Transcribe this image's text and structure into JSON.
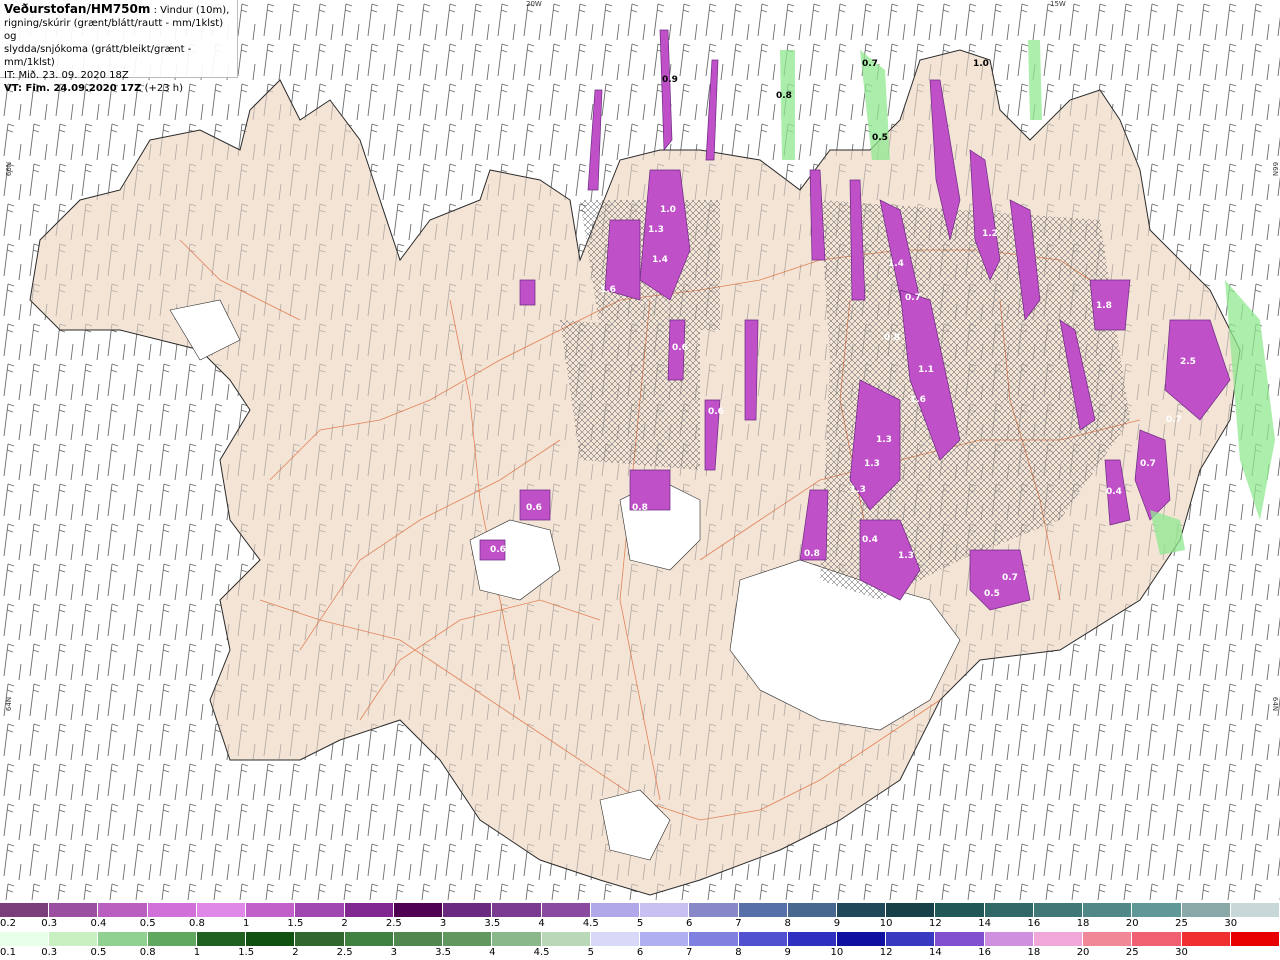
{
  "title": {
    "source": "Veðurstofan/HM750m",
    "desc_line1": " : Vindur (10m),",
    "desc_line2": "rigning/skúrir (grænt/blátt/rautt - mm/1klst) og",
    "desc_line3": "slydda/snjókoma (grátt/bleikt/grænt - mm/1klst)",
    "it": "IT: Mið. 23. 09. 2020 18Z",
    "vt": "VT: Fim. 24.09.2020 17Z",
    "lead": "(+23 h)"
  },
  "graticule": {
    "top_20w": "20W",
    "top_15w": "15W",
    "left_66n": "66N",
    "left_64n": "64N",
    "right_66n": "66N",
    "right_64n": "64N"
  },
  "legend_snow": {
    "labels": [
      "0.2",
      "0.3",
      "0.4",
      "0.5",
      "0.8",
      "1",
      "1.5",
      "2",
      "2.5",
      "3",
      "3.5",
      "4",
      "4.5",
      "5",
      "6",
      "7",
      "8",
      "9",
      "10",
      "12",
      "14",
      "16",
      "18",
      "20",
      "25",
      "30"
    ],
    "colors": [
      "#7a3f7a",
      "#9a4fa0",
      "#b85fc0",
      "#d070d8",
      "#e088e8",
      "#c060c8",
      "#a048b0",
      "#802890",
      "#500050",
      "#6a2a80",
      "#7a3a90",
      "#8a4aa0",
      "#b0a8e8",
      "#c8c0f0",
      "#8888c8",
      "#5870a8",
      "#486890",
      "#204858",
      "#184048",
      "#205858",
      "#306868",
      "#407878",
      "#508888",
      "#609898",
      "#8aa8a8",
      "#c8d8d8"
    ]
  },
  "legend_rain": {
    "labels": [
      "0.1",
      "0.3",
      "0.5",
      "0.8",
      "1",
      "1.5",
      "2",
      "2.5",
      "3",
      "3.5",
      "4",
      "4.5",
      "5",
      "6",
      "7",
      "8",
      "9",
      "10",
      "12",
      "14",
      "16",
      "18",
      "20",
      "25",
      "30"
    ],
    "colors": [
      "#e8ffe8",
      "#c8f0c0",
      "#90d090",
      "#60a860",
      "#206020",
      "#105010",
      "#306830",
      "#408040",
      "#508850",
      "#609860",
      "#8ab88a",
      "#b8d8b8",
      "#d8d8f8",
      "#b0b0f0",
      "#8080e0",
      "#5050d0",
      "#3030c0",
      "#1010a0",
      "#3838c0",
      "#8050d0",
      "#d090e0",
      "#f0a8d8",
      "#f08898",
      "#f06070",
      "#f03030",
      "#e80000"
    ]
  },
  "precip_values": [
    "1.1",
    "0.9",
    "1.0",
    "0.8",
    "1.5",
    "1.4",
    "0.6",
    "0.7",
    "1.2",
    "1.6",
    "0.5",
    "1.3",
    "0.4",
    "1.8",
    "2.5",
    "0.3"
  ],
  "colors": {
    "land": "#f3e4d6",
    "coast": "#2a2a2a",
    "roads": "#e06a3a",
    "glacier": "#ffffff",
    "snow_precip": "#c050c8",
    "rain_precip": "#90e890"
  }
}
